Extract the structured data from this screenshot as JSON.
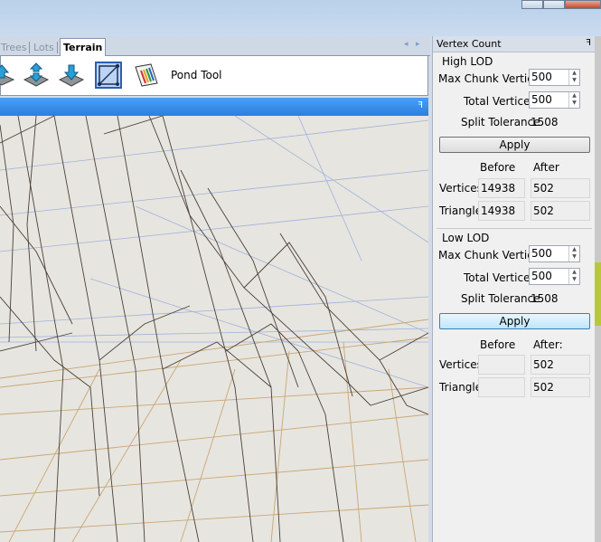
{
  "tabs": [
    {
      "label": "Trees"
    },
    {
      "label": "Lots"
    },
    {
      "label": "Terrain",
      "active": true
    }
  ],
  "tab_nav": {
    "prev": "◂",
    "next": "▸"
  },
  "toolbar": {
    "tools": [
      {
        "icon": "terrain-raise-icon"
      },
      {
        "icon": "terrain-smooth-icon"
      },
      {
        "icon": "terrain-lower-icon"
      },
      {
        "icon": "terrain-edge-icon",
        "selected": true
      },
      {
        "icon": "pond-tool-icon"
      }
    ],
    "active_tool_label": "Pond Tool"
  },
  "viewport_header": {
    "pin": "ꟻ"
  },
  "panel": {
    "title": "Vertex Count",
    "pin": "ꟻ",
    "high_lod": {
      "title": "High LOD",
      "max_chunk_label": "Max Chunk Vertices",
      "max_chunk_value": "500",
      "total_label": "Total Vertices:",
      "total_value": "500",
      "split_label": "Split Tolerance",
      "split_value": "1508",
      "apply_label": "Apply",
      "before_header": "Before",
      "after_header": "After",
      "vertices_label": "Vertices",
      "vertices_before": "14938",
      "vertices_after": "502",
      "triangle_label": "Triangle",
      "triangle_before": "14938",
      "triangle_after": "502"
    },
    "low_lod": {
      "title": "Low LOD",
      "max_chunk_label": "Max Chunk Vertices",
      "max_chunk_value": "500",
      "total_label": "Total Vertices:",
      "total_value": "500",
      "split_label": "Split Tolerance",
      "split_value": "1508",
      "apply_label": "Apply",
      "before_header": "Before",
      "after_header": "After:",
      "vertices_label": "Vertices",
      "vertices_before": "",
      "vertices_after": "502",
      "triangle_label": "Triangle",
      "triangle_before": "",
      "triangle_after": "502"
    }
  },
  "colors": {
    "accent": "#2b7fe0",
    "mesh_dark": "#4a4038",
    "mesh_tan": "#c9a777",
    "mesh_blue": "#9fb2dc"
  }
}
